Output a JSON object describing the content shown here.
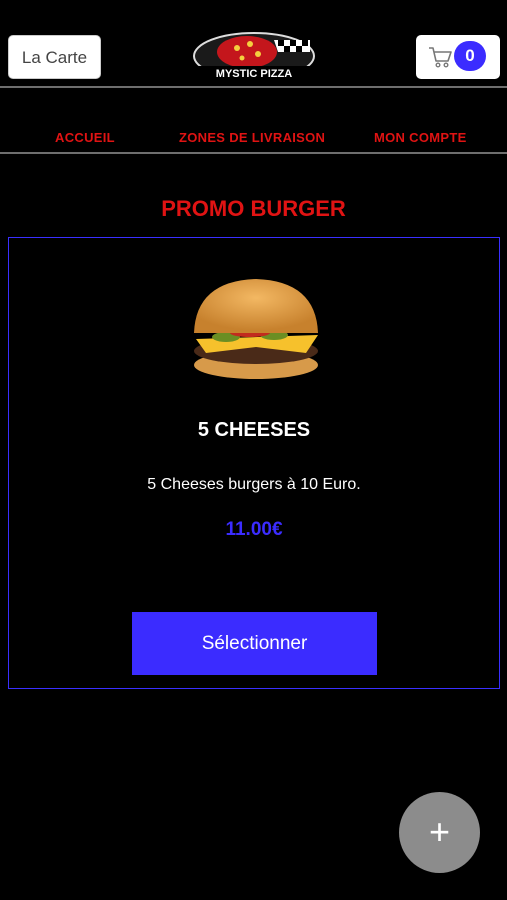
{
  "header": {
    "carte_label": "La Carte",
    "logo_text": "MYSTIC PIZZA",
    "cart_count": "0"
  },
  "nav": {
    "items": [
      {
        "label": "ACCUEIL"
      },
      {
        "label": "ZONES DE LIVRAISON"
      },
      {
        "label": "MON COMPTE"
      }
    ]
  },
  "section": {
    "title": "PROMO BURGER"
  },
  "product": {
    "name": "5 CHEESES",
    "description": "5 Cheeses burgers à 10 Euro.",
    "price": "11.00€",
    "select_label": "Sélectionner"
  },
  "fab": {
    "symbol": "+"
  },
  "colors": {
    "accent_red": "#e01313",
    "accent_blue": "#3b2cff",
    "background": "#000000"
  }
}
